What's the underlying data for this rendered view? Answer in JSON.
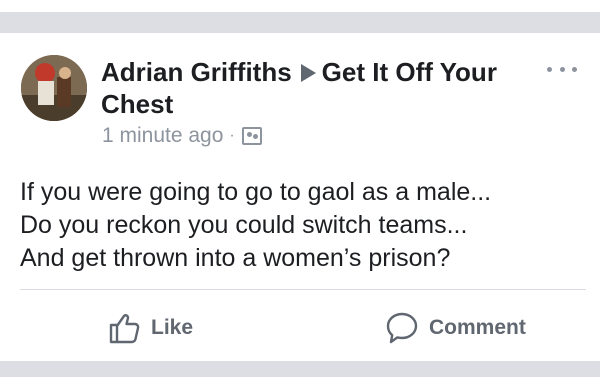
{
  "post": {
    "author": "Adrian Griffiths",
    "group": "Get It Off Your Chest",
    "timestamp": "1 minute ago",
    "separator": "·",
    "audience_icon": "group-photo-icon",
    "more_icon": "more-options-icon",
    "body_lines": [
      "If you were going to go to gaol as a male...",
      "Do you reckon you could switch teams...",
      "And get thrown into a women’s prison?"
    ]
  },
  "actions": {
    "like_label": "Like",
    "comment_label": "Comment"
  },
  "colors": {
    "text": "#1c1e21",
    "muted": "#8d949e",
    "action": "#606770",
    "band": "#dcdee3"
  }
}
